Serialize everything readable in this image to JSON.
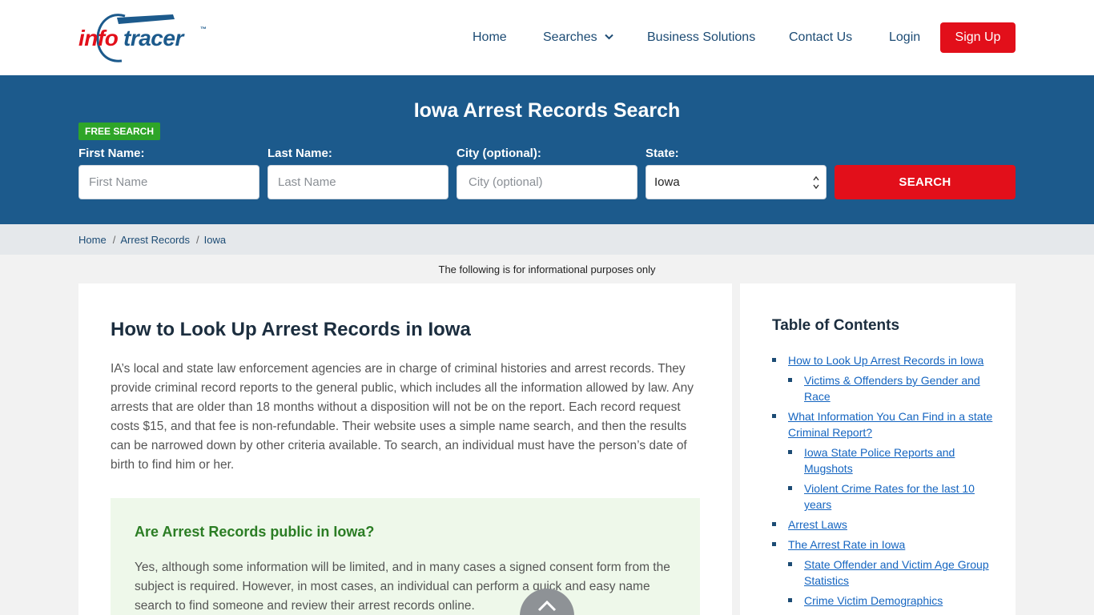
{
  "brand": {
    "logo_info": "info",
    "logo_tracer": "tracer",
    "logo_tm": "™",
    "colors": {
      "red": "#e20f1a",
      "blue": "#1c5a8c",
      "green": "#2ea528"
    }
  },
  "nav": {
    "home": "Home",
    "searches": "Searches",
    "business": "Business Solutions",
    "contact": "Contact Us",
    "login": "Login",
    "signup": "Sign Up"
  },
  "hero": {
    "title": "Iowa Arrest Records Search",
    "badge": "FREE SEARCH",
    "first_label": "First Name:",
    "first_placeholder": "First Name",
    "last_label": "Last Name:",
    "last_placeholder": "Last Name",
    "city_label": "City (optional):",
    "city_placeholder": "City (optional)",
    "state_label": "State:",
    "state_value": "Iowa",
    "search_button": "SEARCH"
  },
  "breadcrumb": {
    "items": [
      "Home",
      "Arrest Records",
      "Iowa"
    ],
    "separator": "/"
  },
  "info_note": "The following is for informational purposes only",
  "article": {
    "title": "How to Look Up Arrest Records in Iowa",
    "paragraph": "IA’s local and state law enforcement agencies are in charge of criminal histories and arrest records. They provide criminal record reports to the general public, which includes all the information allowed by law. Any arrests that are older than 18 months without a disposition will not be on the report. Each record request costs $15, and that fee is non-refundable. Their website uses a simple name search, and then the results can be narrowed down by other criteria available. To search, an individual must have the person’s date of birth to find him or her.",
    "callout_title": "Are Arrest Records public in Iowa?",
    "callout_text": "Yes, although some information will be limited, and in many cases a signed consent form from the subject is required. However, in most cases, an individual can perform a quick and easy name search to find someone and review their arrest records online."
  },
  "toc": {
    "title": "Table of Contents",
    "items": [
      {
        "label": "How to Look Up Arrest Records in Iowa"
      },
      {
        "label": "Victims & Offenders by Gender and Race"
      },
      {
        "label": "What Information You Can Find in a state Criminal Report?"
      },
      {
        "label": "Iowa State Police Reports and Mugshots"
      },
      {
        "label": "Violent Crime Rates for the last 10 years"
      },
      {
        "label": "Arrest Laws"
      },
      {
        "label": "The Arrest Rate in Iowa"
      },
      {
        "label": "State Offender and Victim Age Group Statistics"
      },
      {
        "label": "Crime Victim Demographics"
      }
    ]
  },
  "icons": {
    "scroll_top": "chevron-up-icon",
    "searches_dropdown": "chevron-down-icon",
    "select_arrows": "updown-arrows-icon"
  }
}
